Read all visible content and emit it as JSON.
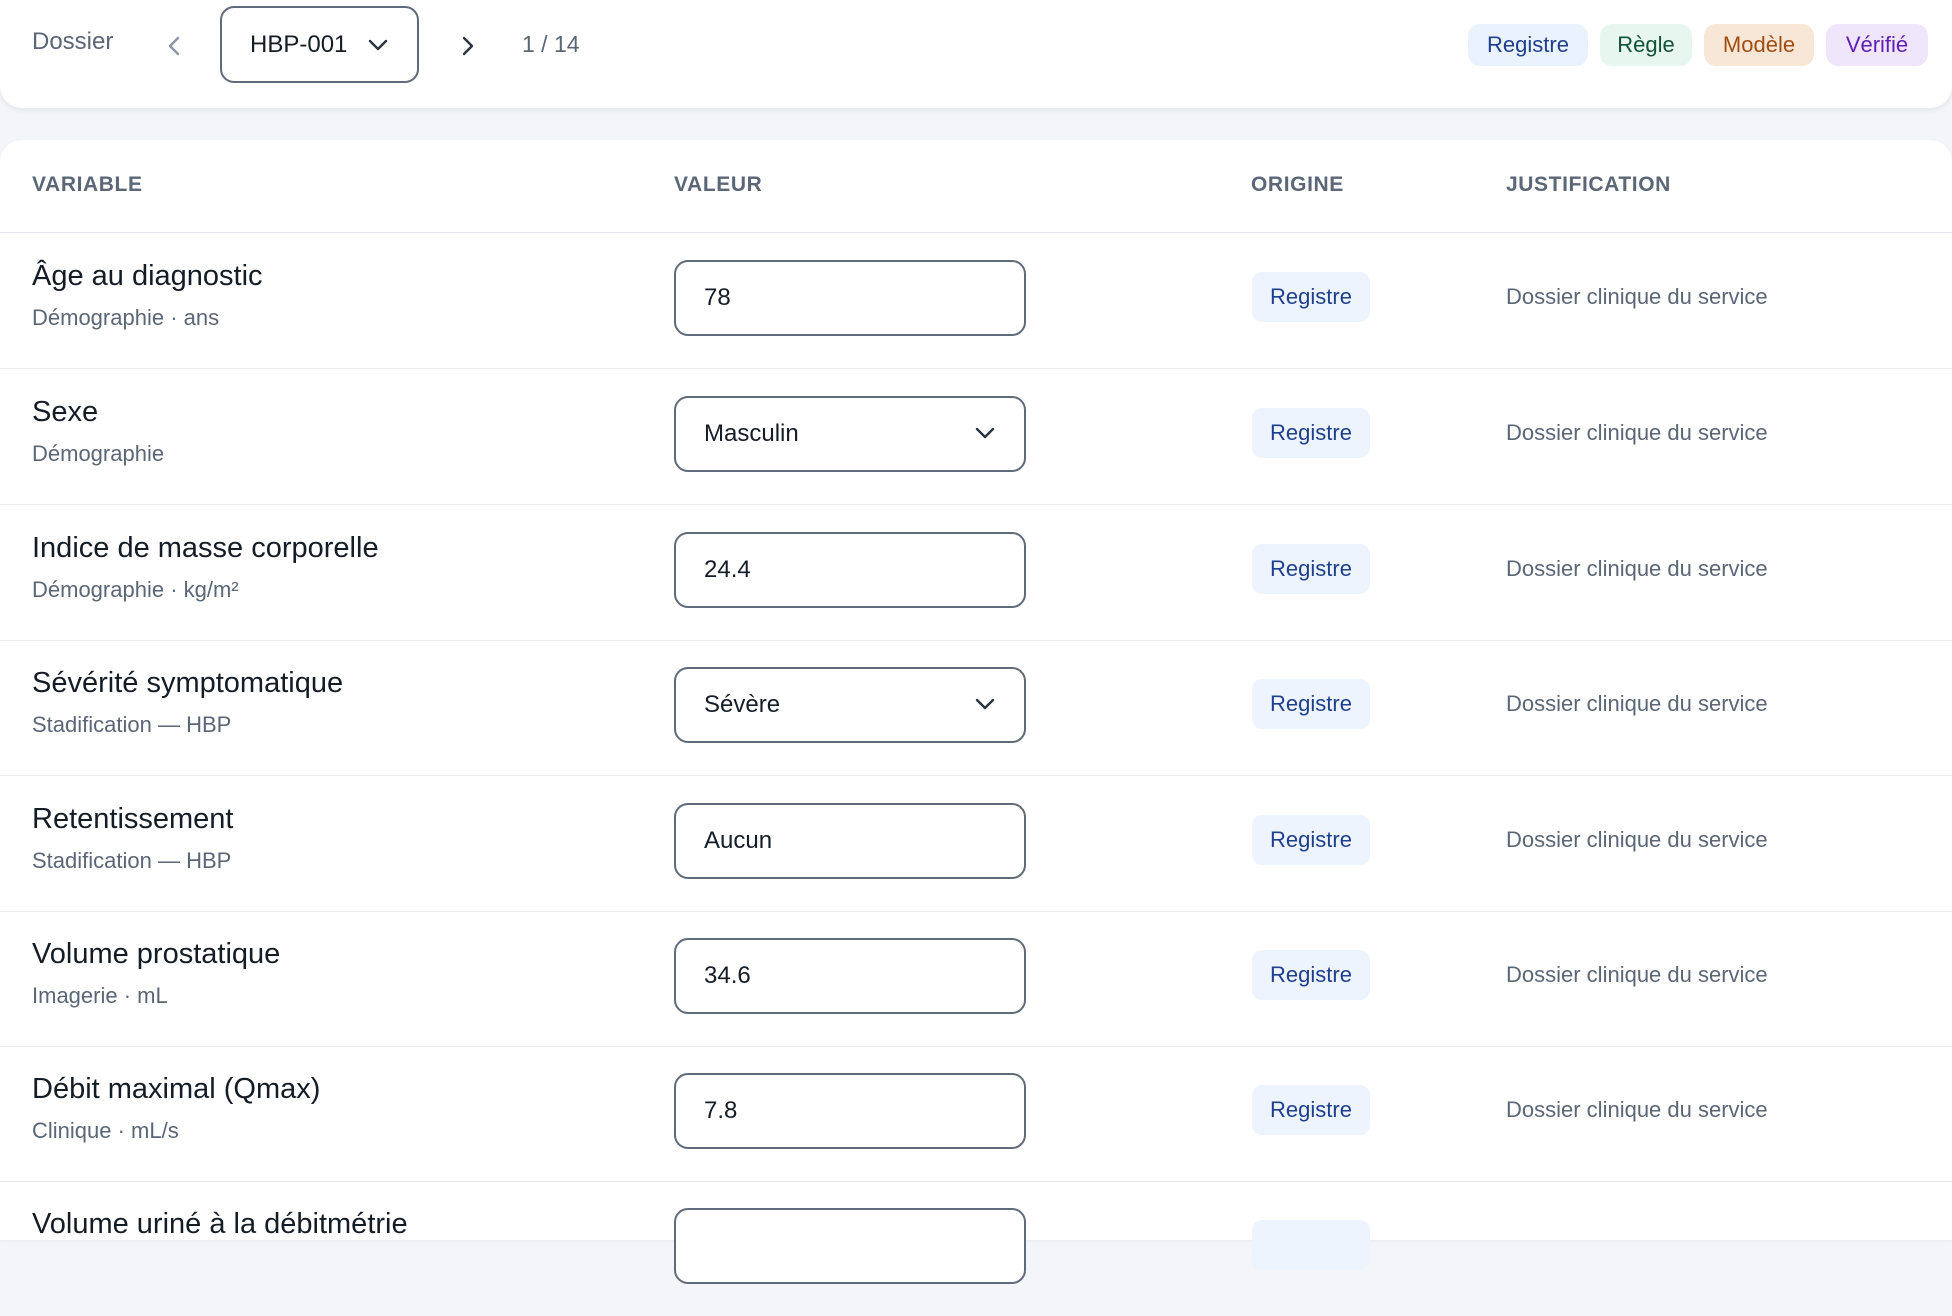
{
  "header": {
    "dossier_label": "Dossier",
    "case_id": "HBP-001",
    "counter": "1 / 14",
    "legend": [
      "Registre",
      "Règle",
      "Modèle",
      "Vérifié"
    ]
  },
  "columns": [
    "VARIABLE",
    "VALEUR",
    "ORIGINE",
    "JUSTIFICATION"
  ],
  "rows": [
    {
      "name": "Âge au diagnostic",
      "meta": "Démographie · ans",
      "value": "78",
      "type": "input",
      "origin": "Registre",
      "justification": "Dossier clinique du service"
    },
    {
      "name": "Sexe",
      "meta": "Démographie",
      "value": "Masculin",
      "type": "select",
      "origin": "Registre",
      "justification": "Dossier clinique du service"
    },
    {
      "name": "Indice de masse corporelle",
      "meta": "Démographie · kg/m²",
      "value": "24.4",
      "type": "input",
      "origin": "Registre",
      "justification": "Dossier clinique du service"
    },
    {
      "name": "Sévérité symptomatique",
      "meta": "Stadification — HBP",
      "value": "Sévère",
      "type": "select",
      "origin": "Registre",
      "justification": "Dossier clinique du service"
    },
    {
      "name": "Retentissement",
      "meta": "Stadification — HBP",
      "value": "Aucun",
      "type": "input",
      "origin": "Registre",
      "justification": "Dossier clinique du service"
    },
    {
      "name": "Volume prostatique",
      "meta": "Imagerie · mL",
      "value": "34.6",
      "type": "input",
      "origin": "Registre",
      "justification": "Dossier clinique du service"
    },
    {
      "name": "Débit maximal (Qmax)",
      "meta": "Clinique · mL/s",
      "value": "7.8",
      "type": "input",
      "origin": "Registre",
      "justification": "Dossier clinique du service"
    },
    {
      "name": "Volume uriné à la débitmétrie",
      "meta": "",
      "value": "",
      "type": "input",
      "origin": "",
      "justification": ""
    }
  ],
  "colors": {
    "registre_bg": "#eaf2fd",
    "registre_fg": "#1d3f8c",
    "regle_bg": "#e7f6ee",
    "regle_fg": "#125238",
    "modele_bg": "#f8e7d6",
    "modele_fg": "#a04d12",
    "verifie_bg": "#efe6fb",
    "verifie_fg": "#5f1fb4"
  },
  "icons": {
    "prev": "chevron-left-icon",
    "next": "chevron-right-icon",
    "dropdown": "chevron-down-icon"
  }
}
